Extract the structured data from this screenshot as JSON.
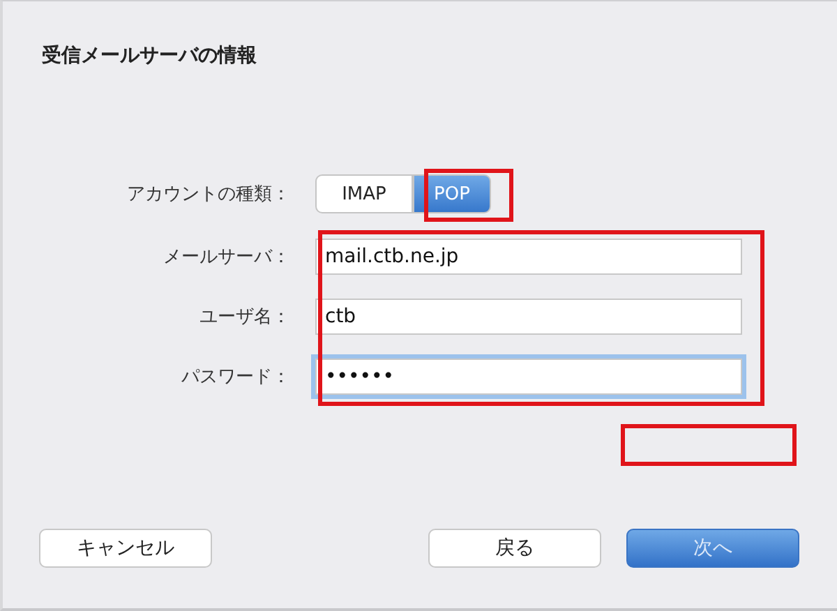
{
  "title": "受信メールサーバの情報",
  "account_type": {
    "label": "アカウントの種類：",
    "options": [
      {
        "label": "IMAP",
        "selected": false
      },
      {
        "label": "POP",
        "selected": true
      }
    ]
  },
  "fields": [
    {
      "label": "メールサーバ：",
      "value": "mail.ctb.ne.jp",
      "focused": false
    },
    {
      "label": "ユーザ名：",
      "value": "ctb",
      "focused": false
    },
    {
      "label": "パスワード：",
      "value": "••••••",
      "focused": true
    }
  ],
  "buttons": [
    {
      "label": "キャンセル",
      "default": false
    },
    {
      "label": "戻る",
      "default": false
    },
    {
      "label": "次へ",
      "default": true
    }
  ]
}
